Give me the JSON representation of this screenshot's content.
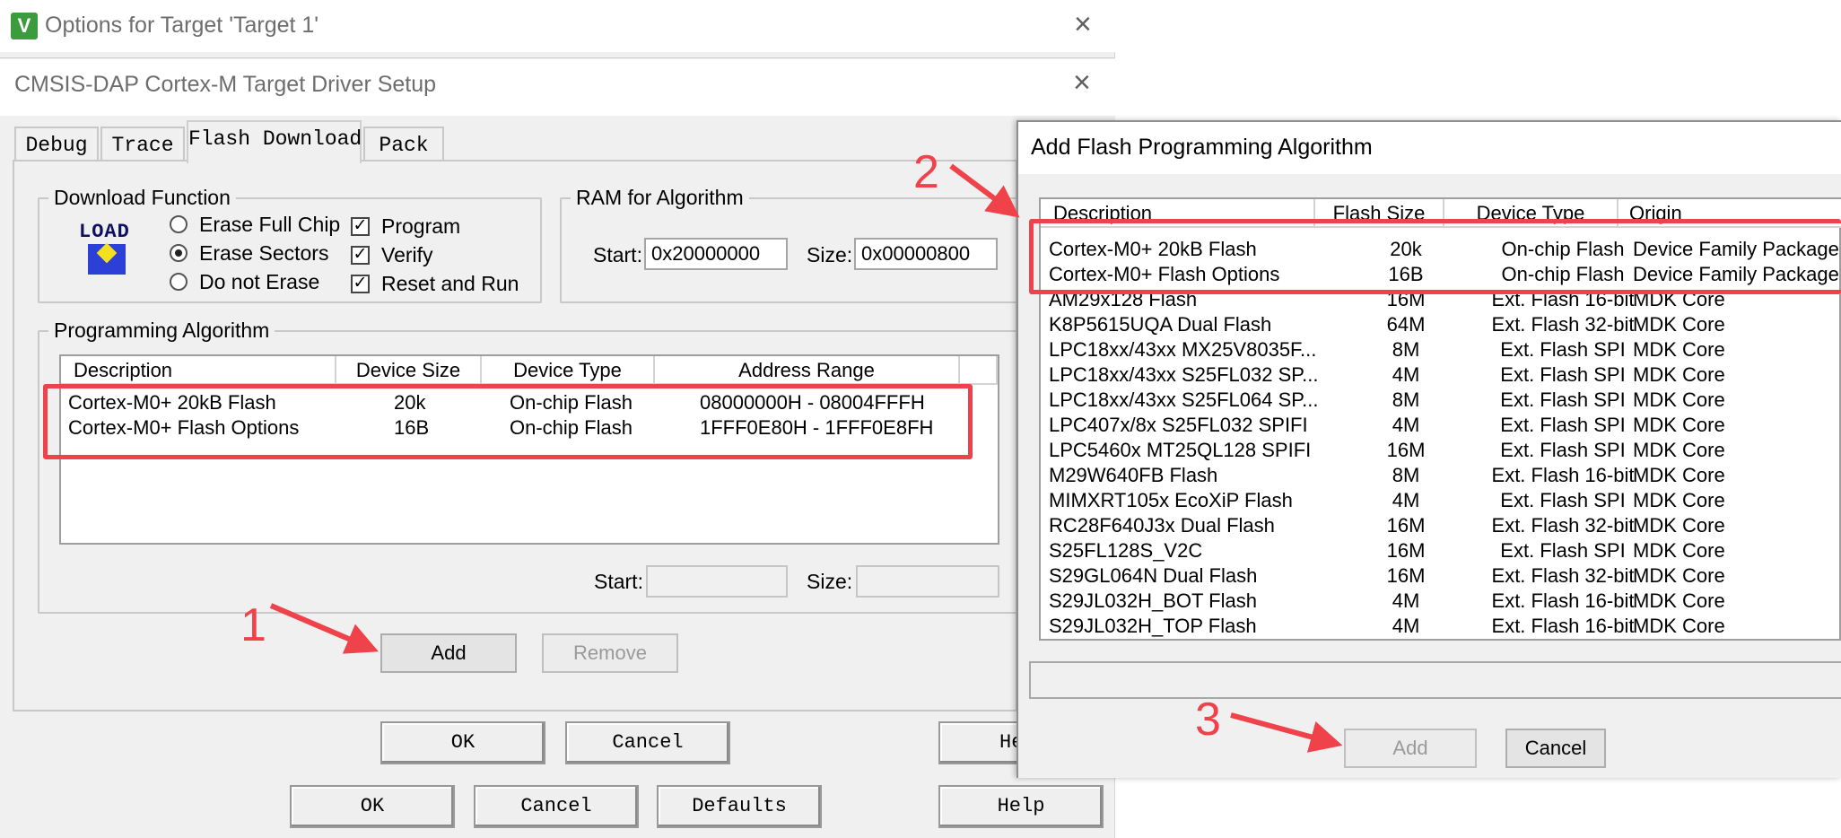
{
  "outer_window": {
    "title": "Options for Target 'Target 1'"
  },
  "inner_window": {
    "title": "CMSIS-DAP Cortex-M Target Driver Setup"
  },
  "tabs": [
    "Debug",
    "Trace",
    "Flash Download",
    "Pack"
  ],
  "download_function": {
    "legend": "Download Function",
    "icon_label": "LOAD",
    "radios": [
      {
        "label": "Erase Full Chip",
        "checked": false
      },
      {
        "label": "Erase Sectors",
        "checked": true
      },
      {
        "label": "Do not Erase",
        "checked": false
      }
    ],
    "checkboxes": [
      {
        "label": "Program",
        "checked": true
      },
      {
        "label": "Verify",
        "checked": true
      },
      {
        "label": "Reset and Run",
        "checked": true
      }
    ]
  },
  "ram_algorithm": {
    "legend": "RAM for Algorithm",
    "start_label": "Start:",
    "start_value": "0x20000000",
    "size_label": "Size:",
    "size_value": "0x00000800"
  },
  "programming_algorithm": {
    "legend": "Programming Algorithm",
    "columns": [
      "Description",
      "Device Size",
      "Device Type",
      "Address Range"
    ],
    "rows": [
      [
        "Cortex-M0+ 20kB Flash",
        "20k",
        "On-chip Flash",
        "08000000H - 08004FFFH"
      ],
      [
        "Cortex-M0+ Flash Options",
        "16B",
        "On-chip Flash",
        "1FFF0E80H - 1FFF0E8FH"
      ]
    ],
    "start_label": "Start:",
    "size_label": "Size:",
    "add_label": "Add",
    "remove_label": "Remove"
  },
  "inner_buttons": {
    "ok": "OK",
    "cancel": "Cancel",
    "help": "He"
  },
  "outer_buttons": {
    "ok": "OK",
    "cancel": "Cancel",
    "defaults": "Defaults",
    "help": "Help"
  },
  "add_dialog": {
    "title": "Add Flash Programming Algorithm",
    "columns": [
      "Description",
      "Flash Size",
      "Device Type",
      "Origin"
    ],
    "rows": [
      [
        "Cortex-M0+ 20kB Flash",
        "20k",
        "On-chip Flash",
        "Device Family Package"
      ],
      [
        "Cortex-M0+ Flash Options",
        "16B",
        "On-chip Flash",
        "Device Family Package"
      ],
      [
        "AM29x128 Flash",
        "16M",
        "Ext. Flash 16-bit",
        "MDK Core"
      ],
      [
        "K8P5615UQA Dual Flash",
        "64M",
        "Ext. Flash 32-bit",
        "MDK Core"
      ],
      [
        "LPC18xx/43xx MX25V8035F...",
        "8M",
        "Ext. Flash SPI",
        "MDK Core"
      ],
      [
        "LPC18xx/43xx S25FL032 SP...",
        "4M",
        "Ext. Flash SPI",
        "MDK Core"
      ],
      [
        "LPC18xx/43xx S25FL064 SP...",
        "8M",
        "Ext. Flash SPI",
        "MDK Core"
      ],
      [
        "LPC407x/8x S25FL032 SPIFI",
        "4M",
        "Ext. Flash SPI",
        "MDK Core"
      ],
      [
        "LPC5460x MT25QL128 SPIFI",
        "16M",
        "Ext. Flash SPI",
        "MDK Core"
      ],
      [
        "M29W640FB Flash",
        "8M",
        "Ext. Flash 16-bit",
        "MDK Core"
      ],
      [
        "MIMXRT105x EcoXiP Flash",
        "4M",
        "Ext. Flash SPI",
        "MDK Core"
      ],
      [
        "RC28F640J3x Dual Flash",
        "16M",
        "Ext. Flash 32-bit",
        "MDK Core"
      ],
      [
        "S25FL128S_V2C",
        "16M",
        "Ext. Flash SPI",
        "MDK Core"
      ],
      [
        "S29GL064N Dual Flash",
        "16M",
        "Ext. Flash 32-bit",
        "MDK Core"
      ],
      [
        "S29JL032H_BOT Flash",
        "4M",
        "Ext. Flash 16-bit",
        "MDK Core"
      ],
      [
        "S29JL032H_TOP Flash",
        "4M",
        "Ext. Flash 16-bit",
        "MDK Core"
      ]
    ],
    "add_label": "Add",
    "cancel_label": "Cancel"
  },
  "annotations": [
    "1",
    "2",
    "3"
  ],
  "colors": {
    "highlight": "#f0424b",
    "app_icon": "#3c9b3c"
  }
}
